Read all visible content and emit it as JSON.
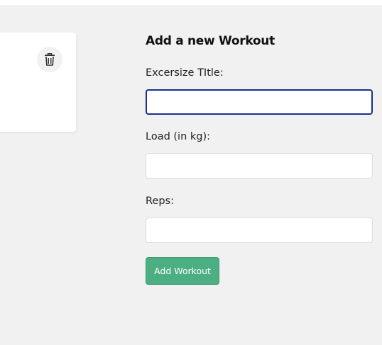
{
  "colors": {
    "page_background": "#f1f1f1",
    "card_background": "#ffffff",
    "accent_primary": "#4caf83",
    "focus_border": "#1a2f8f"
  },
  "workout_card": {
    "delete_icon": "trash-icon"
  },
  "form": {
    "title": "Add a new Workout",
    "fields": [
      {
        "label": "Excersize TItle:",
        "value": "",
        "placeholder": ""
      },
      {
        "label": "Load (in kg):",
        "value": "",
        "placeholder": ""
      },
      {
        "label": "Reps:",
        "value": "",
        "placeholder": ""
      }
    ],
    "submit_label": "Add Workout"
  }
}
